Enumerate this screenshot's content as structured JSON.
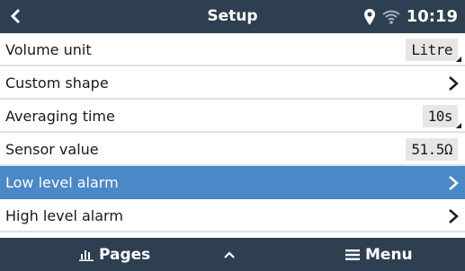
{
  "header": {
    "title": "Setup",
    "time": "10:19"
  },
  "rows": [
    {
      "label": "Volume unit",
      "value": "Litre"
    },
    {
      "label": "Custom shape"
    },
    {
      "label": "Averaging time",
      "value": "10s"
    },
    {
      "label": "Sensor value",
      "value": "51.5Ω"
    },
    {
      "label": "Low level alarm",
      "selected": true
    },
    {
      "label": "High level alarm"
    }
  ],
  "footer": {
    "pages_label": "Pages",
    "menu_label": "Menu"
  },
  "colors": {
    "bar": "#2d3f51",
    "selected": "#4a88c8"
  }
}
